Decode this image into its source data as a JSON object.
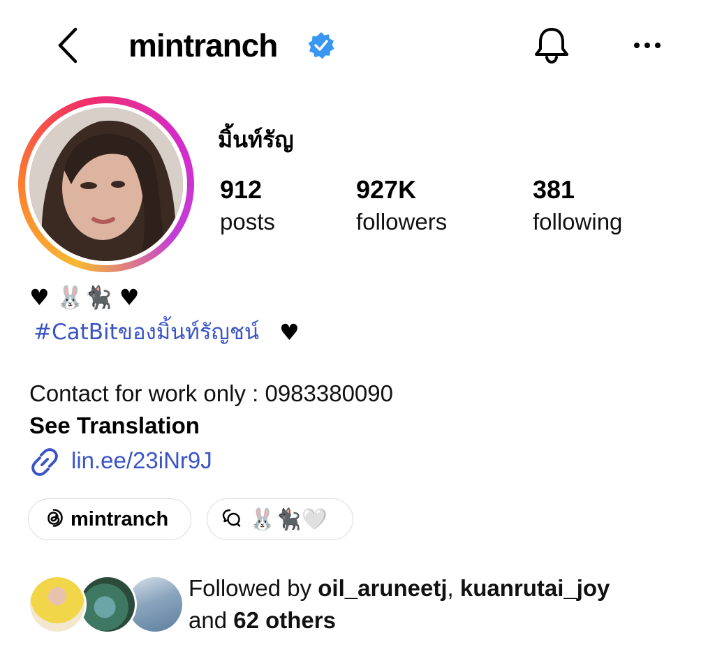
{
  "header": {
    "username": "mintranch",
    "verified": true,
    "icons": [
      "back-arrow-icon",
      "verified-badge-icon",
      "bell-icon",
      "more-options-icon"
    ]
  },
  "profile": {
    "display_name": "มิ้นท์รัญ",
    "stats": {
      "posts_count": "912",
      "posts_label": "posts",
      "followers_count": "927K",
      "followers_label": "followers",
      "following_count": "381",
      "following_label": "following"
    }
  },
  "bio": {
    "line1": "♥ 🐰🐈‍⬛ ♥",
    "hashtag": "#CatBitของมิ้นท์รัญชน์",
    "hashtag_suffix": "♥",
    "contact": "Contact for work only : 0983380090",
    "see_translation": "See Translation",
    "link": "lin.ee/23iNr9J"
  },
  "chips": {
    "threads_label": "mintranch",
    "note_label": "🐰🐈‍⬛🤍"
  },
  "followed_by": {
    "prefix": "Followed by",
    "user1": "oil_aruneetj",
    "separator": ",",
    "user2": "kuanrutai_joy",
    "and": "and",
    "others": "62 others"
  },
  "colors": {
    "link_blue": "#3b54c4",
    "verified_blue": "#3897f0",
    "chip_border": "#dcdcdc"
  }
}
